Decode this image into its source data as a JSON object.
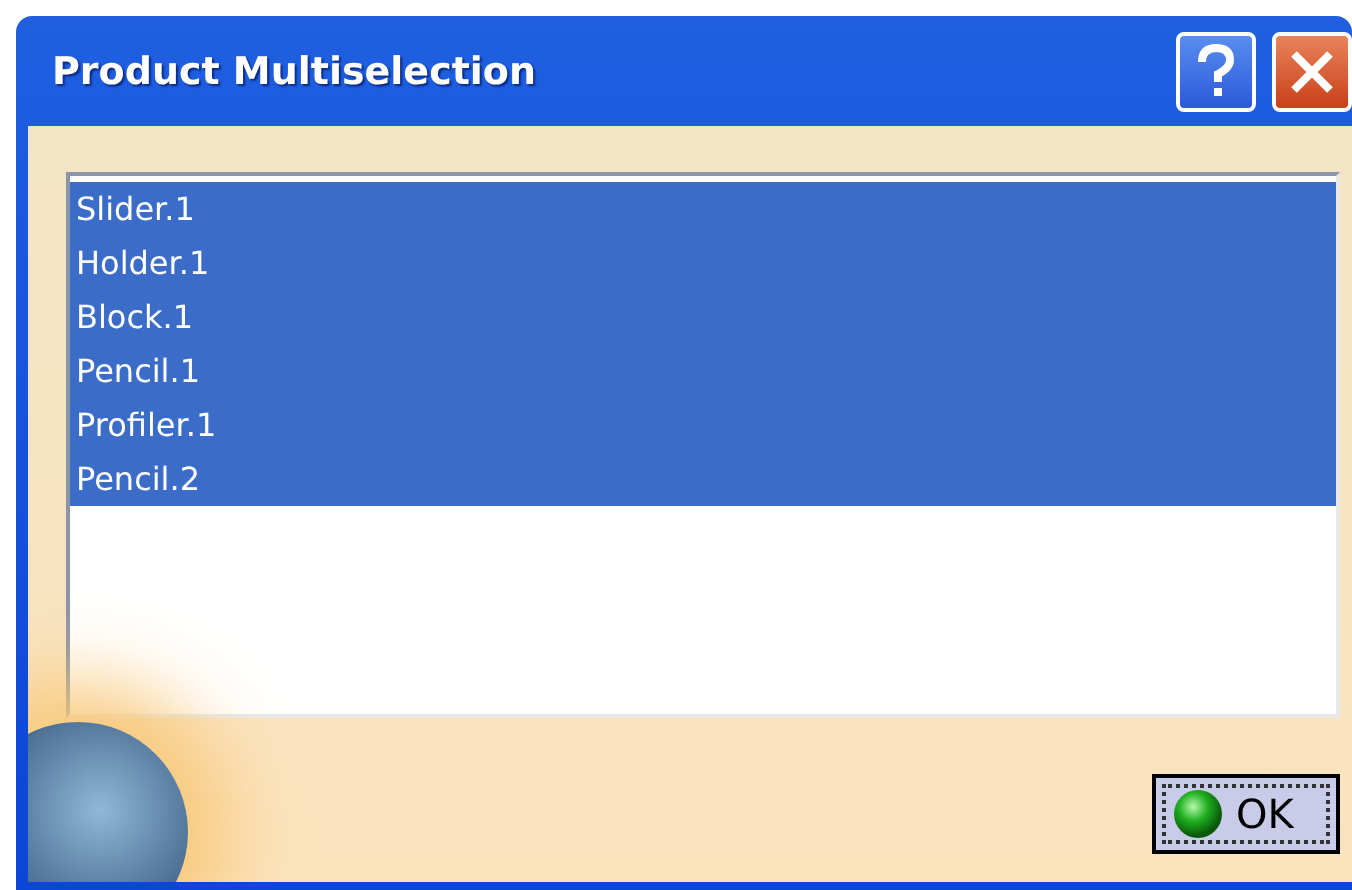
{
  "window": {
    "title": "Product Multiselection"
  },
  "list": {
    "items": [
      {
        "label": "Slider.1",
        "selected": true
      },
      {
        "label": "Holder.1",
        "selected": true
      },
      {
        "label": "Block.1",
        "selected": true
      },
      {
        "label": "Pencil.1",
        "selected": true
      },
      {
        "label": "Profiler.1",
        "selected": true
      },
      {
        "label": "Pencil.2",
        "selected": true
      }
    ]
  },
  "buttons": [
    {
      "label": "OK"
    }
  ]
}
